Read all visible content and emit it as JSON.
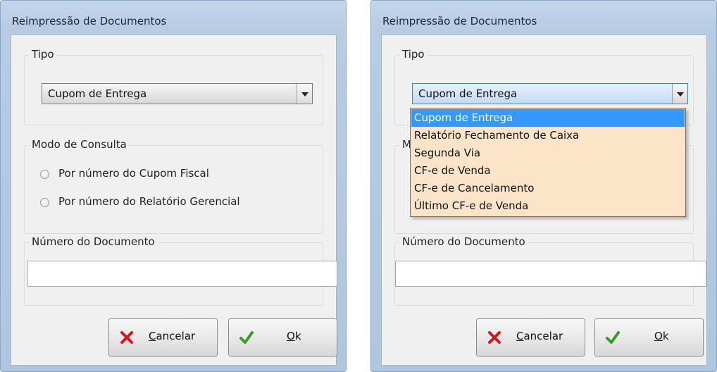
{
  "left_dialog": {
    "title": "Reimpressão de Documentos",
    "tipo": {
      "label": "Tipo",
      "value": "Cupom de Entrega"
    },
    "modo_consulta": {
      "label": "Modo de Consulta",
      "options": [
        "Por número do Cupom Fiscal",
        "Por número do Relatório Gerencial"
      ]
    },
    "numero_documento": {
      "label": "Número do Documento",
      "value": ""
    },
    "buttons": {
      "cancel_mnemonic": "C",
      "cancel_rest": "ancelar",
      "ok_mnemonic": "O",
      "ok_rest": "k"
    }
  },
  "right_dialog": {
    "title": "Reimpressão de Documentos",
    "tipo": {
      "label": "Tipo",
      "value": "Cupom de Entrega"
    },
    "modo_consulta": {
      "label_visible": "M"
    },
    "dropdown": {
      "items": [
        "Cupom de Entrega",
        "Relatório Fechamento de Caixa",
        "Segunda Via",
        "CF-e de Venda",
        "CF-e de Cancelamento",
        "Último CF-e de Venda"
      ],
      "selected_index": 0
    },
    "numero_documento": {
      "label": "Número do Documento",
      "value": ""
    },
    "buttons": {
      "cancel_mnemonic": "C",
      "cancel_rest": "ancelar",
      "ok_mnemonic": "O",
      "ok_rest": "k"
    }
  },
  "icons": {
    "cancel": "red-x-icon",
    "ok": "green-check-icon"
  },
  "colors": {
    "title_bar": "#b7cce3",
    "dropdown_bg": "#fce4c8",
    "selection": "#3399ff",
    "cancel_icon": "#d8141c",
    "ok_icon": "#3a9a2c"
  }
}
